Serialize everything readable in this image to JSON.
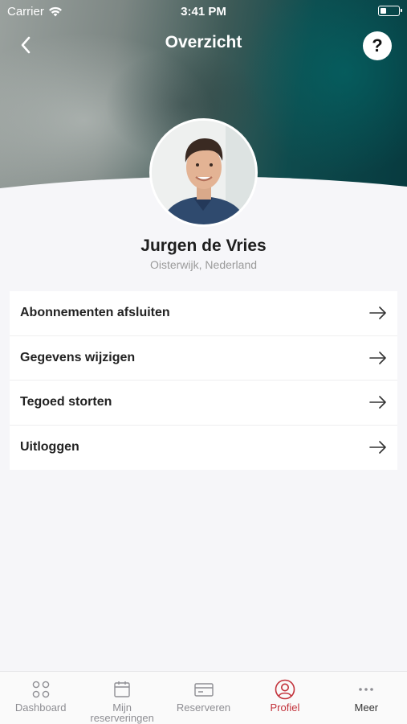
{
  "status_bar": {
    "carrier": "Carrier",
    "time": "3:41 PM"
  },
  "header": {
    "title": "Overzicht",
    "help_label": "?"
  },
  "profile": {
    "name": "Jurgen de Vries",
    "location": "Oisterwijk, Nederland"
  },
  "menu": {
    "items": [
      {
        "label": "Abonnementen afsluiten",
        "icon": "arrow-right-icon"
      },
      {
        "label": "Gegevens wijzigen",
        "icon": "arrow-right-icon"
      },
      {
        "label": "Tegoed storten",
        "icon": "arrow-right-icon"
      },
      {
        "label": "Uitloggen",
        "icon": "arrow-right-icon"
      }
    ]
  },
  "tabbar": {
    "items": [
      {
        "label": "Dashboard",
        "icon": "dashboard-icon",
        "active": false
      },
      {
        "label": "Mijn\nreserveringen",
        "icon": "calendar-icon",
        "active": false
      },
      {
        "label": "Reserveren",
        "icon": "card-icon",
        "active": false
      },
      {
        "label": "Profiel",
        "icon": "profile-icon",
        "active": true
      },
      {
        "label": "Meer",
        "icon": "more-icon",
        "active": false
      }
    ]
  },
  "colors": {
    "accent": "#c2313a",
    "hero_teal": "#0e4b4d",
    "background": "#f6f6f9"
  }
}
